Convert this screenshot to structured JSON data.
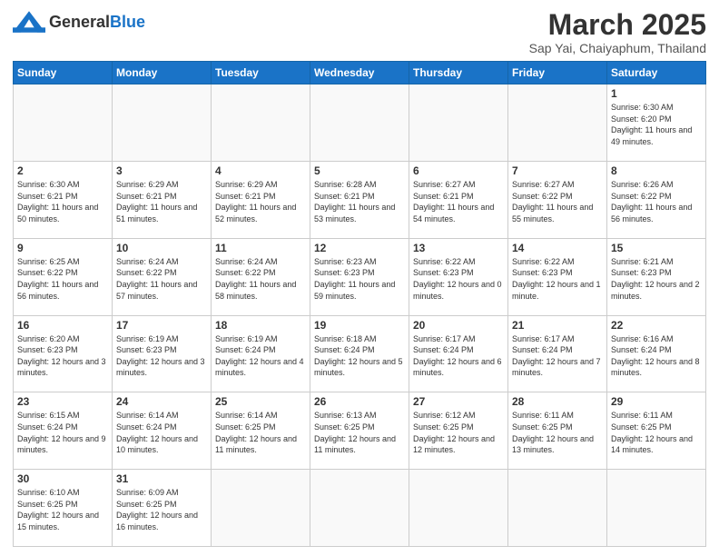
{
  "header": {
    "logo_general": "General",
    "logo_blue": "Blue",
    "month_title": "March 2025",
    "subtitle": "Sap Yai, Chaiyaphum, Thailand"
  },
  "weekdays": [
    "Sunday",
    "Monday",
    "Tuesday",
    "Wednesday",
    "Thursday",
    "Friday",
    "Saturday"
  ],
  "weeks": [
    [
      {
        "day": "",
        "info": ""
      },
      {
        "day": "",
        "info": ""
      },
      {
        "day": "",
        "info": ""
      },
      {
        "day": "",
        "info": ""
      },
      {
        "day": "",
        "info": ""
      },
      {
        "day": "",
        "info": ""
      },
      {
        "day": "1",
        "info": "Sunrise: 6:30 AM\nSunset: 6:20 PM\nDaylight: 11 hours and 49 minutes."
      }
    ],
    [
      {
        "day": "2",
        "info": "Sunrise: 6:30 AM\nSunset: 6:21 PM\nDaylight: 11 hours and 50 minutes."
      },
      {
        "day": "3",
        "info": "Sunrise: 6:29 AM\nSunset: 6:21 PM\nDaylight: 11 hours and 51 minutes."
      },
      {
        "day": "4",
        "info": "Sunrise: 6:29 AM\nSunset: 6:21 PM\nDaylight: 11 hours and 52 minutes."
      },
      {
        "day": "5",
        "info": "Sunrise: 6:28 AM\nSunset: 6:21 PM\nDaylight: 11 hours and 53 minutes."
      },
      {
        "day": "6",
        "info": "Sunrise: 6:27 AM\nSunset: 6:21 PM\nDaylight: 11 hours and 54 minutes."
      },
      {
        "day": "7",
        "info": "Sunrise: 6:27 AM\nSunset: 6:22 PM\nDaylight: 11 hours and 55 minutes."
      },
      {
        "day": "8",
        "info": "Sunrise: 6:26 AM\nSunset: 6:22 PM\nDaylight: 11 hours and 56 minutes."
      }
    ],
    [
      {
        "day": "9",
        "info": "Sunrise: 6:25 AM\nSunset: 6:22 PM\nDaylight: 11 hours and 56 minutes."
      },
      {
        "day": "10",
        "info": "Sunrise: 6:24 AM\nSunset: 6:22 PM\nDaylight: 11 hours and 57 minutes."
      },
      {
        "day": "11",
        "info": "Sunrise: 6:24 AM\nSunset: 6:22 PM\nDaylight: 11 hours and 58 minutes."
      },
      {
        "day": "12",
        "info": "Sunrise: 6:23 AM\nSunset: 6:23 PM\nDaylight: 11 hours and 59 minutes."
      },
      {
        "day": "13",
        "info": "Sunrise: 6:22 AM\nSunset: 6:23 PM\nDaylight: 12 hours and 0 minutes."
      },
      {
        "day": "14",
        "info": "Sunrise: 6:22 AM\nSunset: 6:23 PM\nDaylight: 12 hours and 1 minute."
      },
      {
        "day": "15",
        "info": "Sunrise: 6:21 AM\nSunset: 6:23 PM\nDaylight: 12 hours and 2 minutes."
      }
    ],
    [
      {
        "day": "16",
        "info": "Sunrise: 6:20 AM\nSunset: 6:23 PM\nDaylight: 12 hours and 3 minutes."
      },
      {
        "day": "17",
        "info": "Sunrise: 6:19 AM\nSunset: 6:23 PM\nDaylight: 12 hours and 3 minutes."
      },
      {
        "day": "18",
        "info": "Sunrise: 6:19 AM\nSunset: 6:24 PM\nDaylight: 12 hours and 4 minutes."
      },
      {
        "day": "19",
        "info": "Sunrise: 6:18 AM\nSunset: 6:24 PM\nDaylight: 12 hours and 5 minutes."
      },
      {
        "day": "20",
        "info": "Sunrise: 6:17 AM\nSunset: 6:24 PM\nDaylight: 12 hours and 6 minutes."
      },
      {
        "day": "21",
        "info": "Sunrise: 6:17 AM\nSunset: 6:24 PM\nDaylight: 12 hours and 7 minutes."
      },
      {
        "day": "22",
        "info": "Sunrise: 6:16 AM\nSunset: 6:24 PM\nDaylight: 12 hours and 8 minutes."
      }
    ],
    [
      {
        "day": "23",
        "info": "Sunrise: 6:15 AM\nSunset: 6:24 PM\nDaylight: 12 hours and 9 minutes."
      },
      {
        "day": "24",
        "info": "Sunrise: 6:14 AM\nSunset: 6:24 PM\nDaylight: 12 hours and 10 minutes."
      },
      {
        "day": "25",
        "info": "Sunrise: 6:14 AM\nSunset: 6:25 PM\nDaylight: 12 hours and 11 minutes."
      },
      {
        "day": "26",
        "info": "Sunrise: 6:13 AM\nSunset: 6:25 PM\nDaylight: 12 hours and 11 minutes."
      },
      {
        "day": "27",
        "info": "Sunrise: 6:12 AM\nSunset: 6:25 PM\nDaylight: 12 hours and 12 minutes."
      },
      {
        "day": "28",
        "info": "Sunrise: 6:11 AM\nSunset: 6:25 PM\nDaylight: 12 hours and 13 minutes."
      },
      {
        "day": "29",
        "info": "Sunrise: 6:11 AM\nSunset: 6:25 PM\nDaylight: 12 hours and 14 minutes."
      }
    ],
    [
      {
        "day": "30",
        "info": "Sunrise: 6:10 AM\nSunset: 6:25 PM\nDaylight: 12 hours and 15 minutes."
      },
      {
        "day": "31",
        "info": "Sunrise: 6:09 AM\nSunset: 6:25 PM\nDaylight: 12 hours and 16 minutes."
      },
      {
        "day": "",
        "info": ""
      },
      {
        "day": "",
        "info": ""
      },
      {
        "day": "",
        "info": ""
      },
      {
        "day": "",
        "info": ""
      },
      {
        "day": "",
        "info": ""
      }
    ]
  ]
}
